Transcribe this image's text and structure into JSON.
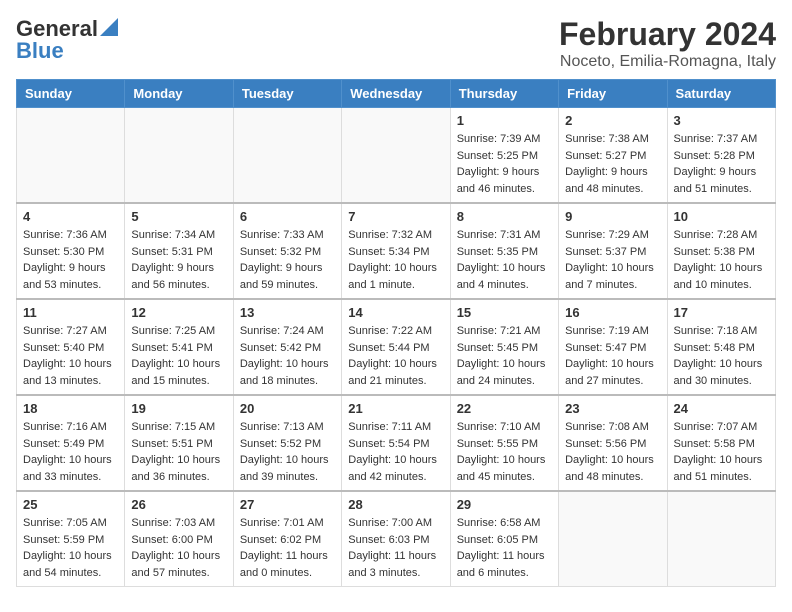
{
  "logo": {
    "general": "General",
    "blue": "Blue"
  },
  "title": "February 2024",
  "subtitle": "Noceto, Emilia-Romagna, Italy",
  "headers": [
    "Sunday",
    "Monday",
    "Tuesday",
    "Wednesday",
    "Thursday",
    "Friday",
    "Saturday"
  ],
  "weeks": [
    [
      {
        "day": "",
        "info": ""
      },
      {
        "day": "",
        "info": ""
      },
      {
        "day": "",
        "info": ""
      },
      {
        "day": "",
        "info": ""
      },
      {
        "day": "1",
        "info": "Sunrise: 7:39 AM\nSunset: 5:25 PM\nDaylight: 9 hours\nand 46 minutes."
      },
      {
        "day": "2",
        "info": "Sunrise: 7:38 AM\nSunset: 5:27 PM\nDaylight: 9 hours\nand 48 minutes."
      },
      {
        "day": "3",
        "info": "Sunrise: 7:37 AM\nSunset: 5:28 PM\nDaylight: 9 hours\nand 51 minutes."
      }
    ],
    [
      {
        "day": "4",
        "info": "Sunrise: 7:36 AM\nSunset: 5:30 PM\nDaylight: 9 hours\nand 53 minutes."
      },
      {
        "day": "5",
        "info": "Sunrise: 7:34 AM\nSunset: 5:31 PM\nDaylight: 9 hours\nand 56 minutes."
      },
      {
        "day": "6",
        "info": "Sunrise: 7:33 AM\nSunset: 5:32 PM\nDaylight: 9 hours\nand 59 minutes."
      },
      {
        "day": "7",
        "info": "Sunrise: 7:32 AM\nSunset: 5:34 PM\nDaylight: 10 hours\nand 1 minute."
      },
      {
        "day": "8",
        "info": "Sunrise: 7:31 AM\nSunset: 5:35 PM\nDaylight: 10 hours\nand 4 minutes."
      },
      {
        "day": "9",
        "info": "Sunrise: 7:29 AM\nSunset: 5:37 PM\nDaylight: 10 hours\nand 7 minutes."
      },
      {
        "day": "10",
        "info": "Sunrise: 7:28 AM\nSunset: 5:38 PM\nDaylight: 10 hours\nand 10 minutes."
      }
    ],
    [
      {
        "day": "11",
        "info": "Sunrise: 7:27 AM\nSunset: 5:40 PM\nDaylight: 10 hours\nand 13 minutes."
      },
      {
        "day": "12",
        "info": "Sunrise: 7:25 AM\nSunset: 5:41 PM\nDaylight: 10 hours\nand 15 minutes."
      },
      {
        "day": "13",
        "info": "Sunrise: 7:24 AM\nSunset: 5:42 PM\nDaylight: 10 hours\nand 18 minutes."
      },
      {
        "day": "14",
        "info": "Sunrise: 7:22 AM\nSunset: 5:44 PM\nDaylight: 10 hours\nand 21 minutes."
      },
      {
        "day": "15",
        "info": "Sunrise: 7:21 AM\nSunset: 5:45 PM\nDaylight: 10 hours\nand 24 minutes."
      },
      {
        "day": "16",
        "info": "Sunrise: 7:19 AM\nSunset: 5:47 PM\nDaylight: 10 hours\nand 27 minutes."
      },
      {
        "day": "17",
        "info": "Sunrise: 7:18 AM\nSunset: 5:48 PM\nDaylight: 10 hours\nand 30 minutes."
      }
    ],
    [
      {
        "day": "18",
        "info": "Sunrise: 7:16 AM\nSunset: 5:49 PM\nDaylight: 10 hours\nand 33 minutes."
      },
      {
        "day": "19",
        "info": "Sunrise: 7:15 AM\nSunset: 5:51 PM\nDaylight: 10 hours\nand 36 minutes."
      },
      {
        "day": "20",
        "info": "Sunrise: 7:13 AM\nSunset: 5:52 PM\nDaylight: 10 hours\nand 39 minutes."
      },
      {
        "day": "21",
        "info": "Sunrise: 7:11 AM\nSunset: 5:54 PM\nDaylight: 10 hours\nand 42 minutes."
      },
      {
        "day": "22",
        "info": "Sunrise: 7:10 AM\nSunset: 5:55 PM\nDaylight: 10 hours\nand 45 minutes."
      },
      {
        "day": "23",
        "info": "Sunrise: 7:08 AM\nSunset: 5:56 PM\nDaylight: 10 hours\nand 48 minutes."
      },
      {
        "day": "24",
        "info": "Sunrise: 7:07 AM\nSunset: 5:58 PM\nDaylight: 10 hours\nand 51 minutes."
      }
    ],
    [
      {
        "day": "25",
        "info": "Sunrise: 7:05 AM\nSunset: 5:59 PM\nDaylight: 10 hours\nand 54 minutes."
      },
      {
        "day": "26",
        "info": "Sunrise: 7:03 AM\nSunset: 6:00 PM\nDaylight: 10 hours\nand 57 minutes."
      },
      {
        "day": "27",
        "info": "Sunrise: 7:01 AM\nSunset: 6:02 PM\nDaylight: 11 hours\nand 0 minutes."
      },
      {
        "day": "28",
        "info": "Sunrise: 7:00 AM\nSunset: 6:03 PM\nDaylight: 11 hours\nand 3 minutes."
      },
      {
        "day": "29",
        "info": "Sunrise: 6:58 AM\nSunset: 6:05 PM\nDaylight: 11 hours\nand 6 minutes."
      },
      {
        "day": "",
        "info": ""
      },
      {
        "day": "",
        "info": ""
      }
    ]
  ]
}
